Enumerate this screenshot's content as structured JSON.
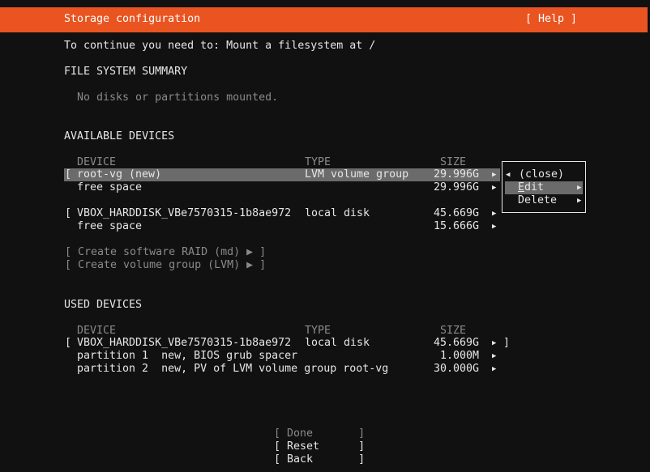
{
  "header": {
    "title": "Storage configuration",
    "help": "[ Help ]"
  },
  "message": "To continue you need to: Mount a filesystem at /",
  "summary": {
    "heading": "FILE SYSTEM SUMMARY",
    "empty": "No disks or partitions mounted."
  },
  "available": {
    "heading": "AVAILABLE DEVICES",
    "columns": {
      "device": "DEVICE",
      "type": "TYPE",
      "size": "SIZE"
    },
    "rows": [
      {
        "bracket": "[",
        "device": "root-vg (new)",
        "type": "LVM volume group",
        "size": "29.996G",
        "arrow": "▶"
      },
      {
        "bracket": "",
        "device": "free space",
        "type": "",
        "size": "29.996G",
        "arrow": "▶"
      },
      {
        "bracket": "[",
        "device": "VBOX_HARDDISK_VBe7570315-1b8ae972",
        "type": "local disk",
        "size": "45.669G",
        "arrow": "▶"
      },
      {
        "bracket": "",
        "device": "free space",
        "type": "",
        "size": "15.666G",
        "arrow": "▶"
      }
    ],
    "actions": [
      "[ Create software RAID (md) ▶ ]",
      "[ Create volume group (LVM) ▶ ]"
    ]
  },
  "used": {
    "heading": "USED DEVICES",
    "columns": {
      "device": "DEVICE",
      "type": "TYPE",
      "size": "SIZE"
    },
    "rows": [
      {
        "bracket": "[",
        "device": "VBOX_HARDDISK_VBe7570315-1b8ae972",
        "type": "local disk",
        "size": "45.669G",
        "arrow": "▶",
        "close": "]"
      },
      {
        "bracket": "",
        "device": "partition 1  new, BIOS grub spacer",
        "type": "",
        "size": "1.000M",
        "arrow": "▶",
        "close": ""
      },
      {
        "bracket": "",
        "device": "partition 2  new, PV of LVM volume group root-vg",
        "type": "",
        "size": "30.000G",
        "arrow": "▶",
        "close": ""
      }
    ]
  },
  "popup": {
    "close": "(close)",
    "close_arrow": "◀",
    "edit_first": "E",
    "edit_rest": "dit",
    "delete": "Delete",
    "arrow": "▶"
  },
  "buttons": {
    "done": "[ Done       ]",
    "reset": "[ Reset      ]",
    "back": "[ Back       ]"
  }
}
